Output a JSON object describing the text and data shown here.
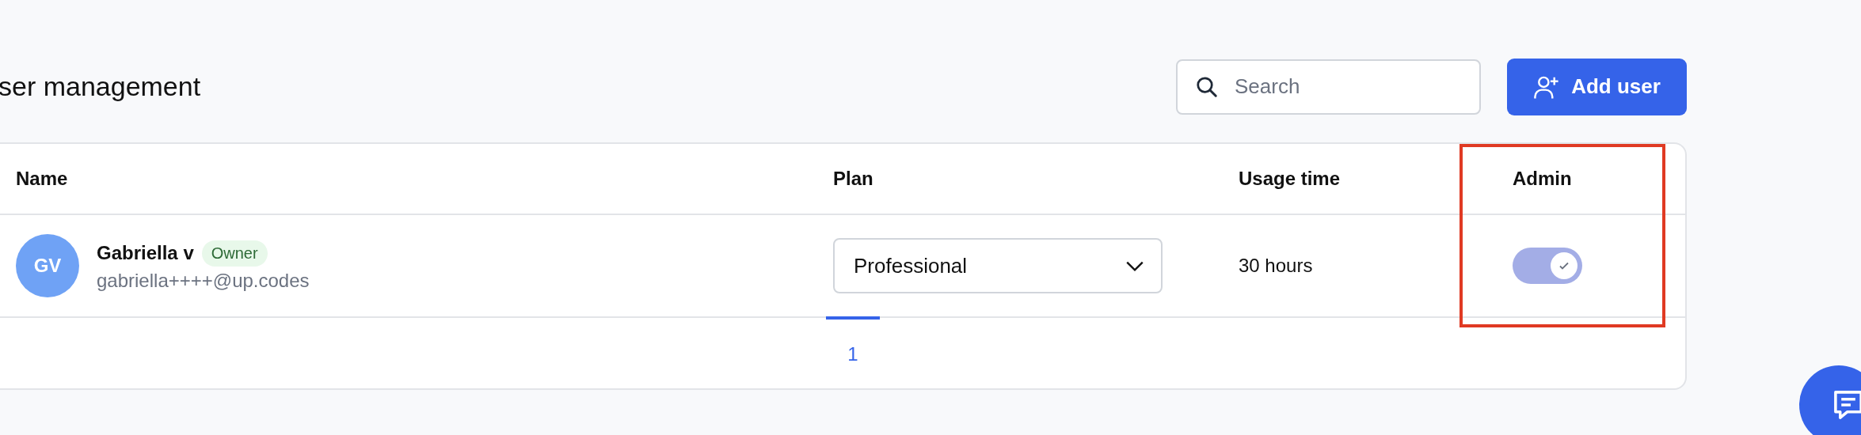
{
  "page": {
    "title": "ser management"
  },
  "search": {
    "placeholder": "Search"
  },
  "add_button": {
    "label": "Add user"
  },
  "table": {
    "columns": [
      "Name",
      "Plan",
      "Usage time",
      "Admin"
    ],
    "rows": [
      {
        "initials": "GV",
        "name": "Gabriella v",
        "badge": "Owner",
        "email": "gabriella++++@up.codes",
        "plan": "Professional",
        "usage": "30 hours",
        "admin": true
      }
    ]
  },
  "pagination": [
    {
      "label": "1",
      "selected": true
    }
  ],
  "highlight": true
}
